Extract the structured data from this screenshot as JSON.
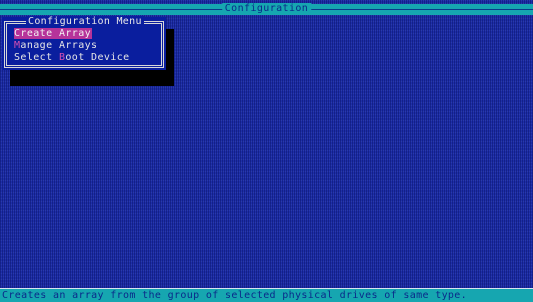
{
  "window": {
    "title": "Configuration"
  },
  "menu": {
    "title": "Configuration Menu",
    "items": [
      {
        "hotkey": "C",
        "rest": "reate Array",
        "selected": true
      },
      {
        "hotkey": "M",
        "rest": "anage Arrays",
        "selected": false
      },
      {
        "prefix": "Select ",
        "hotkey": "B",
        "rest": "oot Device",
        "selected": false
      }
    ]
  },
  "status": {
    "text": "Creates an array from the group of selected physical drives of same type."
  },
  "colors": {
    "background": "#1e2ea8",
    "titlebar": "#16a6b0",
    "highlight": "#b6339a",
    "hotkey": "#d84fb2"
  }
}
